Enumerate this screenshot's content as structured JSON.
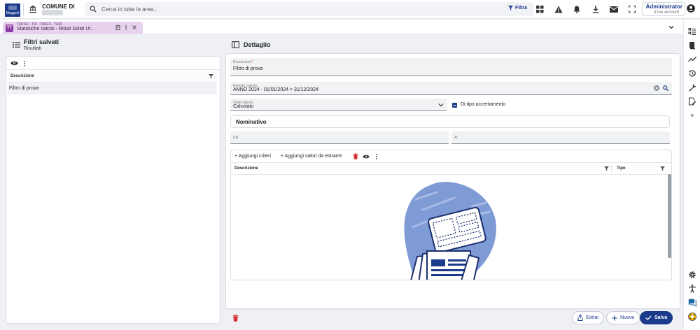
{
  "app": {
    "logo_text": "Maggioli",
    "comune_label": "COMUNE DI"
  },
  "search": {
    "placeholder": "Cerca in tutte le aree...",
    "filter_label": "Filtra"
  },
  "user": {
    "name": "Administrator",
    "subtitle": "Il tuo account"
  },
  "tab": {
    "badge": "TT",
    "supertitle": "TARSU - TIA - TARES - TARI",
    "title": "Statistiche calcoli - Rifiuti Solidi Ur..."
  },
  "left": {
    "title": "Filtri salvati",
    "subtitle": "Risultati",
    "column_header": "Descrizione",
    "rows": [
      "Filtro di prova"
    ]
  },
  "right": {
    "title": "Dettaglio",
    "descrizione": {
      "label": "Descrizione",
      "required_mark": "*",
      "value": "Filtro di prova"
    },
    "periodo": {
      "label": "Periodo calcolo",
      "value": "ANNO 2024 - 01/01/2024 > 31/12/2024"
    },
    "stato": {
      "label": "Stato calcolo",
      "value": "Calcolato"
    },
    "accertamento_label": "Di tipo accertamento",
    "nominativo_title": "Nominativo",
    "dal_label": "Dal",
    "al_label": "Al",
    "aggiungi_criteri": "Aggiungi criteri",
    "aggiungi_valori": "Aggiungi valori da estrarre",
    "col_descrizione": "Descrizione",
    "col_tipo": "Tipo"
  },
  "footer": {
    "estrai": "Estrai",
    "nuovo": "Nuovo",
    "salva": "Salva"
  },
  "colors": {
    "brand": "#1b3a8c",
    "tab_bg": "#e7d2ee",
    "danger": "#d32f2f"
  }
}
